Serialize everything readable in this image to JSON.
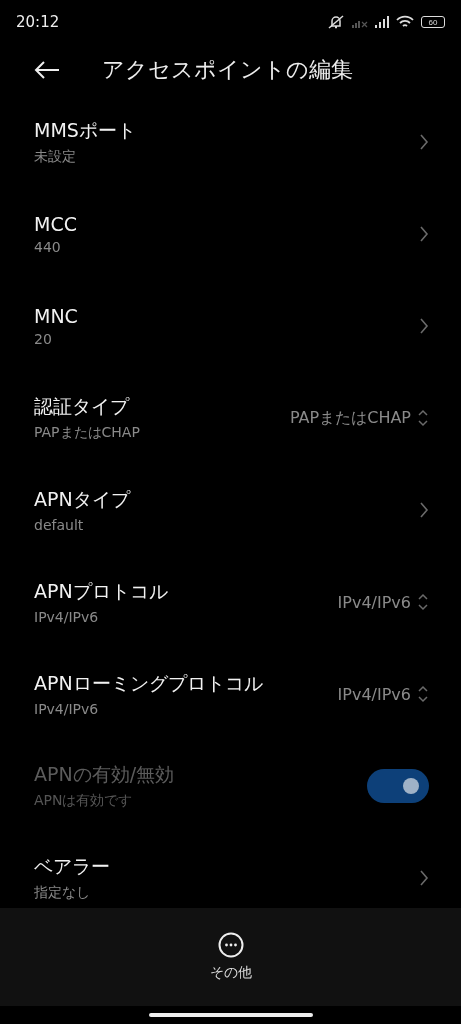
{
  "status_bar": {
    "time": "20:12",
    "battery": "60"
  },
  "header": {
    "title": "アクセスポイントの編集"
  },
  "rows": [
    {
      "kind": "link",
      "title": "MMSポート",
      "subtitle": "未設定"
    },
    {
      "kind": "link",
      "title": "MCC",
      "subtitle": "440"
    },
    {
      "kind": "link",
      "title": "MNC",
      "subtitle": "20"
    },
    {
      "kind": "select",
      "title": "認証タイプ",
      "subtitle": "PAPまたはCHAP",
      "value": "PAPまたはCHAP"
    },
    {
      "kind": "link",
      "title": "APNタイプ",
      "subtitle": "default"
    },
    {
      "kind": "select",
      "title": "APNプロトコル",
      "subtitle": "IPv4/IPv6",
      "value": "IPv4/IPv6"
    },
    {
      "kind": "select",
      "title": "APNローミングプロトコル",
      "subtitle": "IPv4/IPv6",
      "value": "IPv4/IPv6"
    },
    {
      "kind": "toggle",
      "title": "APNの有効/無効",
      "subtitle": "APNは有効です",
      "on": true,
      "disabled": true
    },
    {
      "kind": "link",
      "title": "ベアラー",
      "subtitle": "指定なし"
    }
  ],
  "bottom_bar": {
    "label": "その他"
  }
}
